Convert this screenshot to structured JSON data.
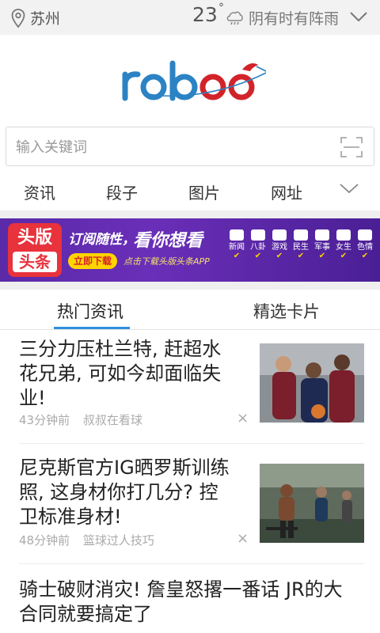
{
  "topbar": {
    "location_icon": "location-pin-icon",
    "city": "苏州",
    "temperature": "23",
    "degree_symbol": "°",
    "weather_icon": "cloud-rain-icon",
    "weather": "阴有时有阵雨",
    "expand_icon": "chevron-down-icon"
  },
  "logo": {
    "text": "roboo"
  },
  "search": {
    "placeholder": "输入关键词",
    "value": "",
    "scan_icon": "scan-icon"
  },
  "categories": {
    "items": [
      "资讯",
      "段子",
      "图片",
      "网址"
    ],
    "more_icon": "chevron-down-icon"
  },
  "banner": {
    "badge_line1": "头版",
    "badge_line2": "头条",
    "slogan1": "订阅随性，",
    "slogan2": "看你想看",
    "button": "立即下载",
    "subtext": "点击下载头版头条APP",
    "channels": [
      "新闻",
      "八卦",
      "游戏",
      "民生",
      "军事",
      "女生",
      "色情"
    ]
  },
  "content_tabs": [
    "热门资讯",
    "精选卡片"
  ],
  "news": [
    {
      "title_lines": [
        "三分力压杜兰特, 赶超水",
        "花兄弟, 可如今却面临失",
        "业!"
      ],
      "time": "43分钟前",
      "source": "叔叔在看球",
      "close": "×"
    },
    {
      "title_lines": [
        "尼克斯官方IG晒罗斯训练",
        "照, 这身材你打几分? 控",
        "卫标准身材!"
      ],
      "time": "48分钟前",
      "source": "篮球过人技巧",
      "close": "×"
    },
    {
      "title_lines": [
        "骑士破财消灾! 詹皇怒撂一番话 JR的大",
        "合同就要搞定了"
      ]
    }
  ],
  "colors": {
    "accent_blue": "#2f8fe0",
    "logo_blue": "#2b83c4",
    "logo_red": "#d2232a",
    "banner_purple": "#5a2aa8",
    "badge_red": "#e8323c"
  }
}
